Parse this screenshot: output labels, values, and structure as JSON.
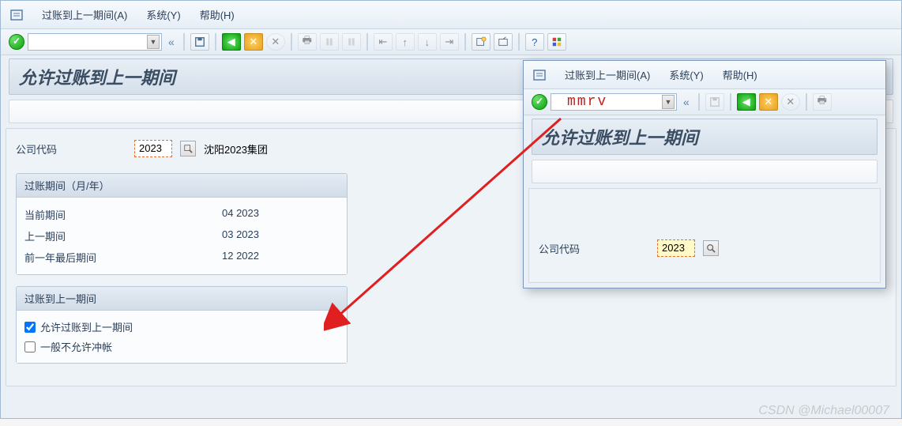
{
  "menu": {
    "items": [
      "过账到上一期间(A)",
      "系统(Y)",
      "帮助(H)"
    ]
  },
  "title": "允许过账到上一期间",
  "company": {
    "label": "公司代码",
    "value": "2023",
    "name": "沈阳2023集团"
  },
  "period_group": {
    "header": "过账期间（月/年）",
    "rows": [
      {
        "label": "当前期间",
        "value": "04 2023"
      },
      {
        "label": "上一期间",
        "value": "03 2023"
      },
      {
        "label": "前一年最后期间",
        "value": "12 2022"
      }
    ]
  },
  "posting_group": {
    "header": "过账到上一期间",
    "allow_label": "允许过账到上一期间",
    "allow_checked": true,
    "reverse_label": "一般不允许冲帐",
    "reverse_checked": false
  },
  "overlay": {
    "menu": [
      "过账到上一期间(A)",
      "系统(Y)",
      "帮助(H)"
    ],
    "command": "mmrv",
    "title": "允许过账到上一期间",
    "company_label": "公司代码",
    "company_value": "2023"
  },
  "watermark": "CSDN @Michael00007"
}
